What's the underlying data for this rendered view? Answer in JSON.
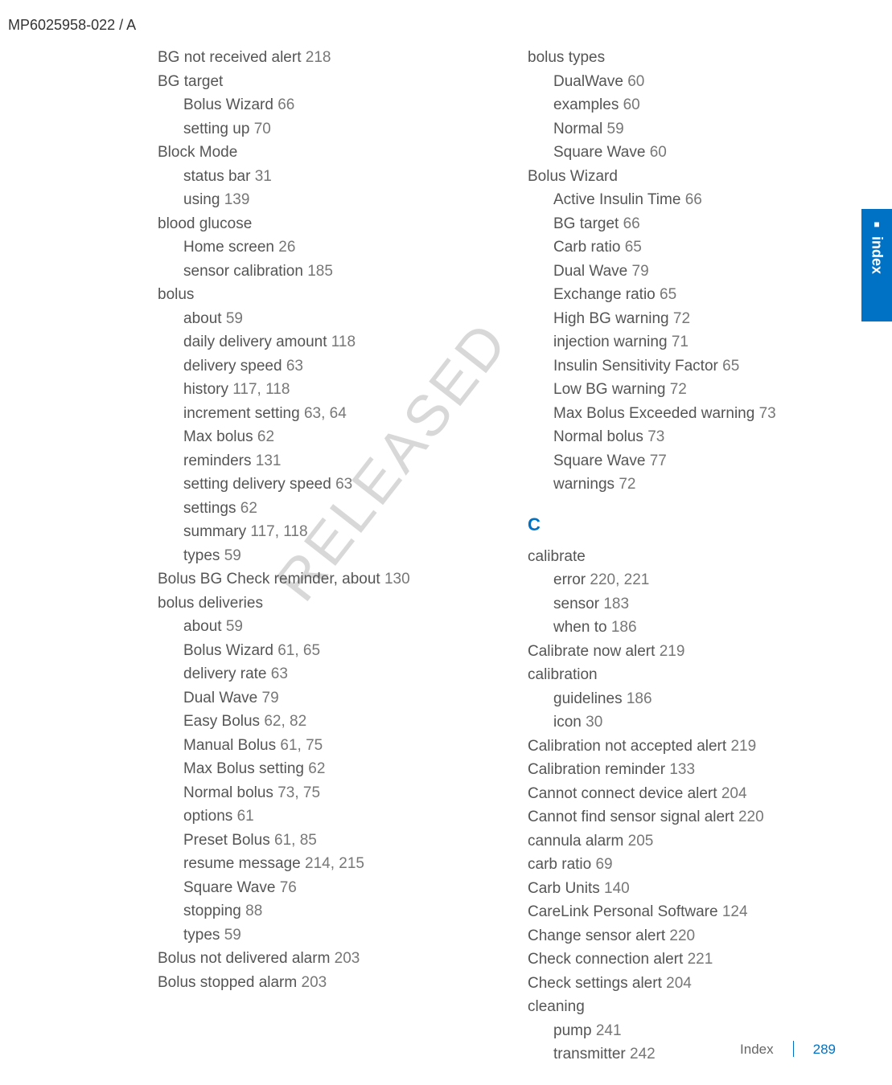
{
  "header": "MP6025958-022 / A",
  "watermark": "RELEASED",
  "sideTab": "index",
  "footer": {
    "label": "Index",
    "page": "289"
  },
  "col1": [
    {
      "t": "BG not received alert  218"
    },
    {
      "t": "BG target"
    },
    {
      "t": "Bolus Wizard  66",
      "s": 1
    },
    {
      "t": "setting up  70",
      "s": 1
    },
    {
      "t": "Block Mode"
    },
    {
      "t": "status bar  31",
      "s": 1
    },
    {
      "t": "using  139",
      "s": 1
    },
    {
      "t": "blood glucose"
    },
    {
      "t": "Home screen  26",
      "s": 1
    },
    {
      "t": "sensor calibration  185",
      "s": 1
    },
    {
      "t": "bolus"
    },
    {
      "t": "about  59",
      "s": 1
    },
    {
      "t": "daily delivery amount  118",
      "s": 1
    },
    {
      "t": "delivery speed  63",
      "s": 1
    },
    {
      "t": "history  117, 118",
      "s": 1
    },
    {
      "t": "increment setting  63, 64",
      "s": 1
    },
    {
      "t": "Max bolus  62",
      "s": 1
    },
    {
      "t": "reminders  131",
      "s": 1
    },
    {
      "t": "setting delivery speed  63",
      "s": 1
    },
    {
      "t": "settings  62",
      "s": 1
    },
    {
      "t": "summary  117, 118",
      "s": 1
    },
    {
      "t": "types  59",
      "s": 1
    },
    {
      "t": "Bolus BG Check reminder, about  130"
    },
    {
      "t": "bolus deliveries"
    },
    {
      "t": "about  59",
      "s": 1
    },
    {
      "t": "Bolus Wizard  61, 65",
      "s": 1
    },
    {
      "t": "delivery rate  63",
      "s": 1
    },
    {
      "t": "Dual Wave  79",
      "s": 1
    },
    {
      "t": "Easy Bolus  62, 82",
      "s": 1
    },
    {
      "t": "Manual Bolus  61, 75",
      "s": 1
    },
    {
      "t": "Max Bolus setting  62",
      "s": 1
    },
    {
      "t": "Normal bolus  73, 75",
      "s": 1
    },
    {
      "t": "options  61",
      "s": 1
    },
    {
      "t": "Preset Bolus  61, 85",
      "s": 1
    },
    {
      "t": "resume message  214, 215",
      "s": 1
    },
    {
      "t": "Square Wave  76",
      "s": 1
    },
    {
      "t": "stopping  88",
      "s": 1
    },
    {
      "t": "types  59",
      "s": 1
    },
    {
      "t": "Bolus not delivered alarm  203"
    },
    {
      "t": "Bolus stopped alarm  203"
    }
  ],
  "col2a": [
    {
      "t": "bolus types"
    },
    {
      "t": "DualWave  60",
      "s": 1
    },
    {
      "t": "examples  60",
      "s": 1
    },
    {
      "t": "Normal  59",
      "s": 1
    },
    {
      "t": "Square Wave  60",
      "s": 1
    },
    {
      "t": "Bolus Wizard"
    },
    {
      "t": "Active Insulin Time  66",
      "s": 1
    },
    {
      "t": "BG target  66",
      "s": 1
    },
    {
      "t": "Carb ratio  65",
      "s": 1
    },
    {
      "t": "Dual Wave  79",
      "s": 1
    },
    {
      "t": "Exchange ratio  65",
      "s": 1
    },
    {
      "t": "High BG warning  72",
      "s": 1
    },
    {
      "t": "injection warning  71",
      "s": 1
    },
    {
      "t": "Insulin Sensitivity Factor  65",
      "s": 1
    },
    {
      "t": "Low BG warning  72",
      "s": 1
    },
    {
      "t": "Max Bolus Exceeded warning  73",
      "s": 1
    },
    {
      "t": "Normal bolus  73",
      "s": 1
    },
    {
      "t": "Square Wave  77",
      "s": 1
    },
    {
      "t": "warnings  72",
      "s": 1
    }
  ],
  "sectionLetter": "C",
  "col2b": [
    {
      "t": "calibrate"
    },
    {
      "t": "error  220, 221",
      "s": 1
    },
    {
      "t": "sensor  183",
      "s": 1
    },
    {
      "t": "when to  186",
      "s": 1
    },
    {
      "t": "Calibrate now alert  219"
    },
    {
      "t": "calibration"
    },
    {
      "t": "guidelines  186",
      "s": 1
    },
    {
      "t": "icon  30",
      "s": 1
    },
    {
      "t": "Calibration not accepted alert  219"
    },
    {
      "t": "Calibration reminder  133"
    },
    {
      "t": "Cannot connect device alert  204"
    },
    {
      "t": "Cannot find sensor signal alert  220"
    },
    {
      "t": "cannula alarm  205"
    },
    {
      "t": "carb ratio  69"
    },
    {
      "t": "Carb Units  140"
    },
    {
      "t": "CareLink Personal Software  124"
    },
    {
      "t": "Change sensor alert  220"
    },
    {
      "t": "Check connection alert  221"
    },
    {
      "t": "Check settings alert  204"
    },
    {
      "t": "cleaning"
    },
    {
      "t": "pump  241",
      "s": 1
    },
    {
      "t": "transmitter  242",
      "s": 1
    }
  ]
}
